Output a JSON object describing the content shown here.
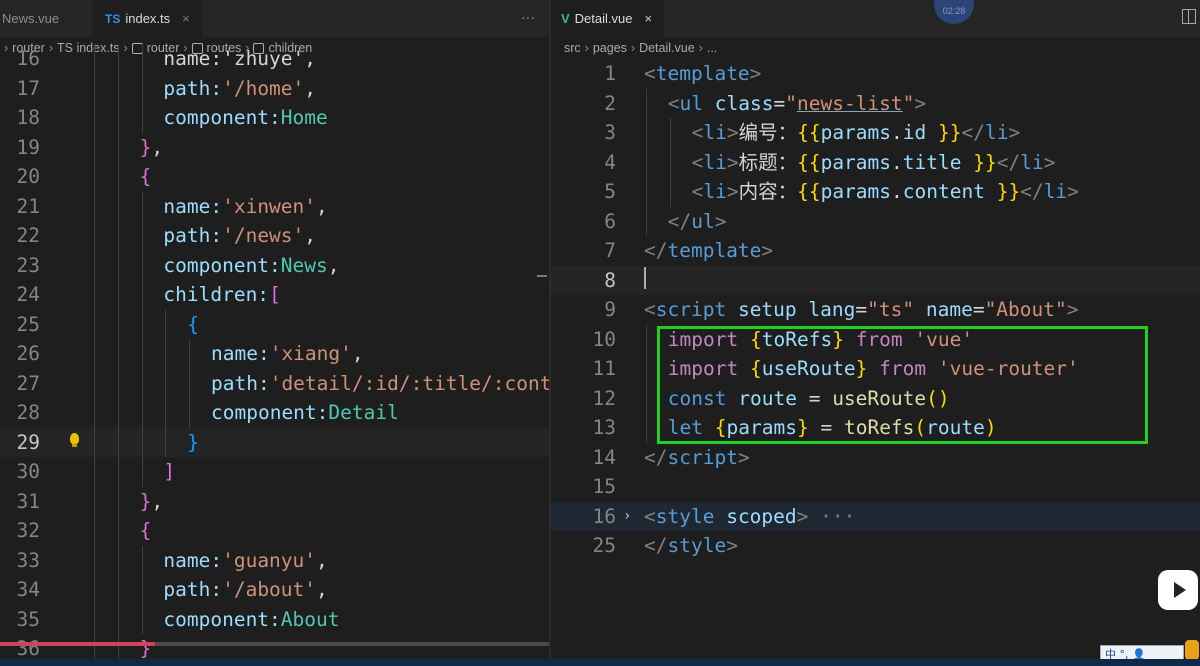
{
  "left_editor": {
    "tabs": [
      {
        "label": "News.vue",
        "active": false
      },
      {
        "label": "index.ts",
        "badge": "TS",
        "active": true,
        "close": "×"
      }
    ],
    "more": "···",
    "breadcrumb": [
      "router",
      "TS index.ts",
      "router",
      "routes",
      "children"
    ],
    "breadcrumb_icons": [
      "",
      "",
      "symbol-variable-icon",
      "wrench-icon",
      "wrench-icon"
    ],
    "lines": [
      {
        "n": "16",
        "indent": 6,
        "segs": [
          [
            "name:'zhuye',",
            "c-txt"
          ]
        ]
      },
      {
        "n": "17",
        "indent": 6,
        "segs": [
          [
            "path:",
            "c-key"
          ],
          [
            "'/home'",
            "c-str"
          ],
          [
            ",",
            "c-txt"
          ]
        ]
      },
      {
        "n": "18",
        "indent": 6,
        "segs": [
          [
            "component:",
            "c-key"
          ],
          [
            "Home",
            "c-cls"
          ]
        ]
      },
      {
        "n": "19",
        "indent": 4,
        "segs": [
          [
            "}",
            "c-p2"
          ],
          [
            ",",
            "c-txt"
          ]
        ]
      },
      {
        "n": "20",
        "indent": 4,
        "segs": [
          [
            "{",
            "c-p2"
          ]
        ]
      },
      {
        "n": "21",
        "indent": 6,
        "segs": [
          [
            "name:",
            "c-key"
          ],
          [
            "'xinwen'",
            "c-str"
          ],
          [
            ",",
            "c-txt"
          ]
        ]
      },
      {
        "n": "22",
        "indent": 6,
        "segs": [
          [
            "path:",
            "c-key"
          ],
          [
            "'/news'",
            "c-str"
          ],
          [
            ",",
            "c-txt"
          ]
        ]
      },
      {
        "n": "23",
        "indent": 6,
        "segs": [
          [
            "component:",
            "c-key"
          ],
          [
            "News",
            "c-cls"
          ],
          [
            ",",
            "c-txt"
          ]
        ]
      },
      {
        "n": "24",
        "indent": 6,
        "segs": [
          [
            "children:",
            "c-key"
          ],
          [
            "[",
            "c-p2"
          ]
        ]
      },
      {
        "n": "25",
        "indent": 8,
        "segs": [
          [
            "{",
            "c-p3"
          ]
        ]
      },
      {
        "n": "26",
        "indent": 10,
        "segs": [
          [
            "name:",
            "c-key"
          ],
          [
            "'xiang'",
            "c-str"
          ],
          [
            ",",
            "c-txt"
          ]
        ]
      },
      {
        "n": "27",
        "indent": 10,
        "segs": [
          [
            "path:",
            "c-key"
          ],
          [
            "'detail/:id/:title/:cont",
            "c-str"
          ]
        ]
      },
      {
        "n": "28",
        "indent": 10,
        "segs": [
          [
            "component:",
            "c-key"
          ],
          [
            "Detail",
            "c-cls"
          ]
        ]
      },
      {
        "n": "29",
        "indent": 8,
        "segs": [
          [
            "}",
            "c-p3"
          ]
        ],
        "current": true,
        "bulb": true
      },
      {
        "n": "30",
        "indent": 6,
        "segs": [
          [
            "]",
            "c-p2"
          ]
        ]
      },
      {
        "n": "31",
        "indent": 4,
        "segs": [
          [
            "}",
            "c-p2"
          ],
          [
            ",",
            "c-txt"
          ]
        ]
      },
      {
        "n": "32",
        "indent": 4,
        "segs": [
          [
            "{",
            "c-p2"
          ]
        ]
      },
      {
        "n": "33",
        "indent": 6,
        "segs": [
          [
            "name:",
            "c-key"
          ],
          [
            "'guanyu'",
            "c-str"
          ],
          [
            ",",
            "c-txt"
          ]
        ]
      },
      {
        "n": "34",
        "indent": 6,
        "segs": [
          [
            "path:",
            "c-key"
          ],
          [
            "'/about'",
            "c-str"
          ],
          [
            ",",
            "c-txt"
          ]
        ]
      },
      {
        "n": "35",
        "indent": 6,
        "segs": [
          [
            "component:",
            "c-key"
          ],
          [
            "About",
            "c-cls"
          ]
        ]
      },
      {
        "n": "36",
        "indent": 4,
        "segs": [
          [
            "}",
            "c-p2"
          ]
        ]
      }
    ]
  },
  "right_editor": {
    "tabs": [
      {
        "label": "Detail.vue",
        "badge": "V",
        "active": true,
        "close": "×"
      }
    ],
    "timer": "02:28",
    "breadcrumb": [
      "src",
      "pages",
      "Detail.vue",
      "..."
    ],
    "lines": [
      {
        "n": "1",
        "indent": 0,
        "segs": [
          [
            "<",
            "c-punc"
          ],
          [
            "template",
            "c-tag"
          ],
          [
            ">",
            "c-punc"
          ]
        ]
      },
      {
        "n": "2",
        "indent": 2,
        "segs": [
          [
            "<",
            "c-punc"
          ],
          [
            "ul",
            "c-tag"
          ],
          [
            " ",
            "c-txt"
          ],
          [
            "class",
            "c-attr"
          ],
          [
            "=",
            "c-txt"
          ],
          [
            "\"",
            "c-str"
          ],
          [
            "news-list",
            "c-str u"
          ],
          [
            "\"",
            "c-str"
          ],
          [
            ">",
            "c-punc"
          ]
        ]
      },
      {
        "n": "3",
        "indent": 4,
        "segs": [
          [
            "<",
            "c-punc"
          ],
          [
            "li",
            "c-tag"
          ],
          [
            ">",
            "c-punc"
          ],
          [
            "编号：",
            "c-txt"
          ],
          [
            "{{",
            "c-p1"
          ],
          [
            "params",
            "c-var"
          ],
          [
            ".",
            "c-txt"
          ],
          [
            "id",
            "c-var"
          ],
          [
            " ",
            "c-txt"
          ],
          [
            "}}",
            "c-p1"
          ],
          [
            "</",
            "c-punc"
          ],
          [
            "li",
            "c-tag"
          ],
          [
            ">",
            "c-punc"
          ]
        ]
      },
      {
        "n": "4",
        "indent": 4,
        "segs": [
          [
            "<",
            "c-punc"
          ],
          [
            "li",
            "c-tag"
          ],
          [
            ">",
            "c-punc"
          ],
          [
            "标题：",
            "c-txt"
          ],
          [
            "{{",
            "c-p1"
          ],
          [
            "params",
            "c-var"
          ],
          [
            ".",
            "c-txt"
          ],
          [
            "title",
            "c-var"
          ],
          [
            " ",
            "c-txt"
          ],
          [
            "}}",
            "c-p1"
          ],
          [
            "</",
            "c-punc"
          ],
          [
            "li",
            "c-tag"
          ],
          [
            ">",
            "c-punc"
          ]
        ]
      },
      {
        "n": "5",
        "indent": 4,
        "segs": [
          [
            "<",
            "c-punc"
          ],
          [
            "li",
            "c-tag"
          ],
          [
            ">",
            "c-punc"
          ],
          [
            "内容：",
            "c-txt"
          ],
          [
            "{{",
            "c-p1"
          ],
          [
            "params",
            "c-var"
          ],
          [
            ".",
            "c-txt"
          ],
          [
            "content",
            "c-var"
          ],
          [
            " ",
            "c-txt"
          ],
          [
            "}}",
            "c-p1"
          ],
          [
            "</",
            "c-punc"
          ],
          [
            "li",
            "c-tag"
          ],
          [
            ">",
            "c-punc"
          ]
        ]
      },
      {
        "n": "6",
        "indent": 2,
        "segs": [
          [
            "</",
            "c-punc"
          ],
          [
            "ul",
            "c-tag"
          ],
          [
            ">",
            "c-punc"
          ]
        ]
      },
      {
        "n": "7",
        "indent": 0,
        "segs": [
          [
            "</",
            "c-punc"
          ],
          [
            "template",
            "c-tag"
          ],
          [
            ">",
            "c-punc"
          ]
        ]
      },
      {
        "n": "8",
        "indent": 0,
        "segs": [],
        "current": true
      },
      {
        "n": "9",
        "indent": 0,
        "segs": [
          [
            "<",
            "c-punc"
          ],
          [
            "script",
            "c-tag"
          ],
          [
            " ",
            "c-txt"
          ],
          [
            "setup",
            "c-attr"
          ],
          [
            " ",
            "c-txt"
          ],
          [
            "lang",
            "c-attr"
          ],
          [
            "=",
            "c-txt"
          ],
          [
            "\"ts\"",
            "c-str"
          ],
          [
            " ",
            "c-txt"
          ],
          [
            "name",
            "c-attr"
          ],
          [
            "=",
            "c-txt"
          ],
          [
            "\"About\"",
            "c-str"
          ],
          [
            ">",
            "c-punc"
          ]
        ]
      },
      {
        "n": "10",
        "indent": 2,
        "segs": [
          [
            "import",
            "c-kw"
          ],
          [
            " ",
            "c-txt"
          ],
          [
            "{",
            "c-p1"
          ],
          [
            "toRefs",
            "c-var"
          ],
          [
            "}",
            "c-p1"
          ],
          [
            " ",
            "c-txt"
          ],
          [
            "from",
            "c-kw"
          ],
          [
            " ",
            "c-txt"
          ],
          [
            "'vue'",
            "c-str"
          ]
        ]
      },
      {
        "n": "11",
        "indent": 2,
        "segs": [
          [
            "import",
            "c-kw"
          ],
          [
            " ",
            "c-txt"
          ],
          [
            "{",
            "c-p1"
          ],
          [
            "useRoute",
            "c-var"
          ],
          [
            "}",
            "c-p1"
          ],
          [
            " ",
            "c-txt"
          ],
          [
            "from",
            "c-kw"
          ],
          [
            " ",
            "c-txt"
          ],
          [
            "'vue-router'",
            "c-str"
          ]
        ]
      },
      {
        "n": "12",
        "indent": 2,
        "segs": [
          [
            "const",
            "c-decl"
          ],
          [
            " ",
            "c-txt"
          ],
          [
            "route",
            "c-var"
          ],
          [
            " = ",
            "c-txt"
          ],
          [
            "useRoute",
            "c-fn"
          ],
          [
            "()",
            "c-p1"
          ]
        ]
      },
      {
        "n": "13",
        "indent": 2,
        "segs": [
          [
            "let",
            "c-decl"
          ],
          [
            " ",
            "c-txt"
          ],
          [
            "{",
            "c-p1"
          ],
          [
            "params",
            "c-var"
          ],
          [
            "}",
            "c-p1"
          ],
          [
            " = ",
            "c-txt"
          ],
          [
            "toRefs",
            "c-fn"
          ],
          [
            "(",
            "c-p1"
          ],
          [
            "route",
            "c-var"
          ],
          [
            ")",
            "c-p1"
          ]
        ]
      },
      {
        "n": "14",
        "indent": 0,
        "segs": [
          [
            "</",
            "c-punc"
          ],
          [
            "script",
            "c-tag"
          ],
          [
            ">",
            "c-punc"
          ]
        ]
      },
      {
        "n": "15",
        "indent": 0,
        "segs": []
      },
      {
        "n": "16",
        "indent": 0,
        "segs": [
          [
            "<",
            "c-punc"
          ],
          [
            "style",
            "c-tag"
          ],
          [
            " ",
            "c-txt"
          ],
          [
            "scoped",
            "c-attr"
          ],
          [
            ">",
            "c-punc"
          ],
          [
            " ···",
            "c-dots"
          ]
        ],
        "folded": true
      },
      {
        "n": "25",
        "indent": 0,
        "segs": [
          [
            "</",
            "c-punc"
          ],
          [
            "style",
            "c-tag"
          ],
          [
            ">",
            "c-punc"
          ]
        ]
      }
    ]
  },
  "overlay": {
    "ime_text": "中 °, 👤"
  }
}
